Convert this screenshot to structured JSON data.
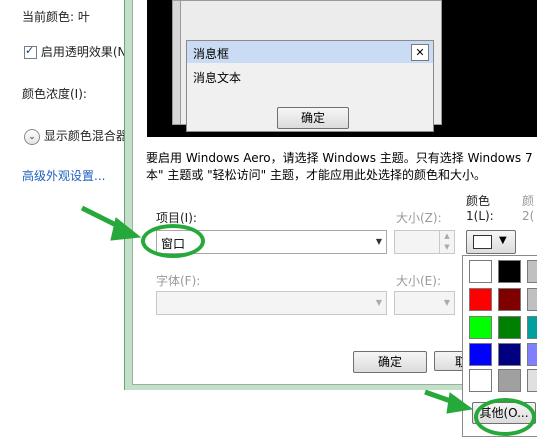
{
  "left_panel": {
    "current_color_label": "当前颜色: 叶",
    "transparency_label": "启用透明效果(N",
    "color_intensity_label": "颜色浓度(I):",
    "show_mixer_label": "显示颜色混合器",
    "advanced_link": "高级外观设置..."
  },
  "preview": {
    "msgbox_title": "消息框",
    "msgbox_close": "✕",
    "msgbox_text": "消息文本",
    "msgbox_ok": "确定"
  },
  "dialog": {
    "info_line1": "要启用 Windows Aero，请选择 Windows 主题。只有选择 Windows 7",
    "info_line2": "本\" 主题或 \"轻松访问\" 主题，才能应用此处选择的颜色和大小。",
    "item_label": "项目(I):",
    "item_value": "窗口",
    "size_label": "大小(Z):",
    "color1_label_top": "颜色",
    "color1_label_bottom": "1(L):",
    "color2_label_top": "颜",
    "color2_label_bottom": "2(",
    "font_label": "字体(F):",
    "font_size_label": "大小(E):",
    "ok_button": "确定",
    "cancel_button_partial": "取",
    "other_button": "其他(O..."
  },
  "palette_colors": [
    "#ffffff",
    "#000000",
    "#c0c0c0",
    "#ff0000",
    "#800000",
    "#c0c0c0",
    "#00ff00",
    "#008000",
    "#00a0a0",
    "#0000ff",
    "#000080",
    "#8080ff",
    "#ffffff",
    "#a0a0a0",
    "#e0e0e0"
  ],
  "accent": {
    "annotation_green": "#27a83a"
  }
}
